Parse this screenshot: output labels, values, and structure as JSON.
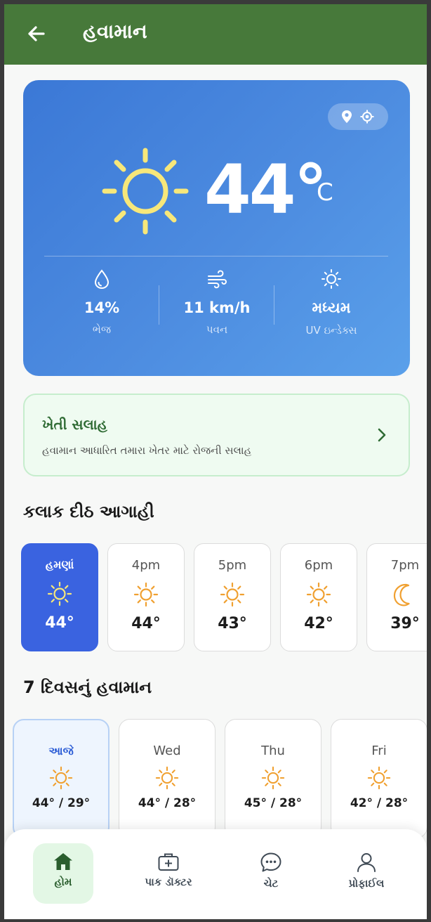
{
  "app": {
    "title": "હવામાન"
  },
  "current": {
    "temperature": "44°",
    "unit": "C",
    "condition_icon": "sun-icon",
    "stats": [
      {
        "icon": "humidity-icon",
        "value": "14%",
        "label": "ભેજ"
      },
      {
        "icon": "wind-icon",
        "value": "11 km/h",
        "label": "પવન"
      },
      {
        "icon": "uv-icon",
        "value": "મધ્યમ",
        "label": "UV ઇન્ડેક્સ"
      }
    ]
  },
  "advice": {
    "title": "ખેતી સલાહ",
    "subtitle": "હવામાન આધારિત તમારા ખેતર માટે રોજની સલાહ"
  },
  "hourly": {
    "title": "કલાક દીઠ આગાહી",
    "items": [
      {
        "time": "હમણાં",
        "icon": "sun-icon",
        "temp": "44°"
      },
      {
        "time": "4pm",
        "icon": "sun-icon",
        "temp": "44°"
      },
      {
        "time": "5pm",
        "icon": "sun-icon",
        "temp": "43°"
      },
      {
        "time": "6pm",
        "icon": "sun-icon",
        "temp": "42°"
      },
      {
        "time": "7pm",
        "icon": "moon-icon",
        "temp": "39°"
      }
    ]
  },
  "daily": {
    "title": "7 દિવસનું હવામાન",
    "items": [
      {
        "day": "આજે",
        "icon": "sun-icon",
        "temp": "44° / 29°"
      },
      {
        "day": "Wed",
        "icon": "sun-icon",
        "temp": "44° / 28°"
      },
      {
        "day": "Thu",
        "icon": "sun-icon",
        "temp": "45° / 28°"
      },
      {
        "day": "Fri",
        "icon": "sun-icon",
        "temp": "42° / 28°"
      }
    ]
  },
  "nav": {
    "items": [
      {
        "label": "હોમ",
        "icon": "home-icon",
        "active": true
      },
      {
        "label": "પાક ડૉક્ટર",
        "icon": "medical-kit-icon",
        "active": false
      },
      {
        "label": "ચેટ",
        "icon": "chat-icon",
        "active": false
      },
      {
        "label": "પ્રોફાઈલ",
        "icon": "profile-icon",
        "active": false
      }
    ]
  },
  "colors": {
    "appbar": "#47793a",
    "card_gradient_start": "#3b78d6",
    "card_gradient_end": "#5aa0ea",
    "now_card": "#3a63e0",
    "sun_icon_card": "#f7e77a",
    "sun_icon_light": "#f0a030",
    "advice_title": "#2f6b34",
    "nav_active_bg": "#e3f7e5"
  }
}
